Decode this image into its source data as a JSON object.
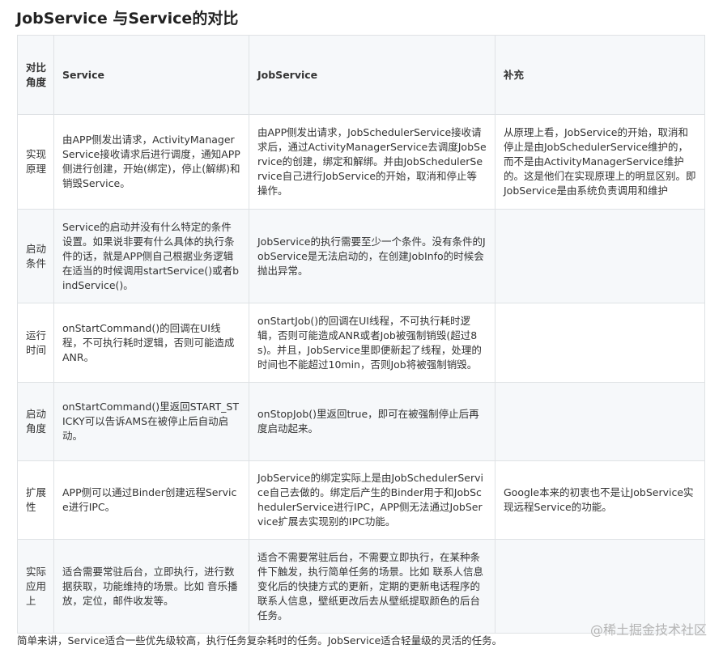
{
  "title": "JobService 与Service的对比",
  "table": {
    "headers": [
      "对比角度",
      "Service",
      "JobService",
      "补充"
    ],
    "rows": [
      [
        "实现原理",
        "由APP侧发出请求，ActivityManagerService接收请求后进行调度，通知APP侧进行创建，开始(绑定)，停止(解绑)和销毁Service。",
        "由APP侧发出请求，JobSchedulerService接收请求后，通过ActivityManagerService去调度JobService的创建，绑定和解绑。并由JobSchedulerService自己进行JobService的开始，取消和停止等操作。",
        "从原理上看，JobService的开始，取消和停止是由JobSchedulerService维护的，而不是由ActivityManagerService维护的。这是他们在实现原理上的明显区别。即JobService是由系统负责调用和维护"
      ],
      [
        "启动条件",
        "Service的启动并没有什么特定的条件设置。如果说非要有什么具体的执行条件的话，就是APP侧自己根据业务逻辑在适当的时候调用startService()或者bindService()。",
        "JobService的执行需要至少一个条件。没有条件的JobService是无法启动的，在创建JobInfo的时候会抛出异常。",
        ""
      ],
      [
        "运行时间",
        "onStartCommand()的回调在UI线程，不可执行耗时逻辑，否则可能造成ANR。",
        "onStartJob()的回调在UI线程，不可执行耗时逻辑，否则可能造成ANR或者Job被强制销毁(超过8s)。并且，JobService里即便新起了线程，处理的时间也不能超过10min，否则Job将被强制销毁。",
        ""
      ],
      [
        "启动角度",
        "onStartCommand()里返回START_STICKY可以告诉AMS在被停止后自动启动。",
        "onStopJob()里返回true，即可在被强制停止后再度启动起来。",
        ""
      ],
      [
        "扩展性",
        "APP侧可以通过Binder创建远程Service进行IPC。",
        "JobService的绑定实际上是由JobSchedulerService自己去做的。绑定后产生的Binder用于和JobSchedulerService进行IPC，APP侧无法通过JobService扩展去实现别的IPC功能。",
        "Google本来的初衷也不是让JobService实现远程Service的功能。"
      ],
      [
        "实际应用上",
        "适合需要常驻后台，立即执行，进行数据获取，功能维持的场景。比如 音乐播放，定位，邮件收发等。",
        "适合不需要常驻后台，不需要立即执行，在某种条件下触发，执行简单任务的场景。比如 联系人信息变化后的快捷方式的更新，定期的更新电话程序的联系人信息，壁纸更改后去从壁纸提取颜色的后台任务。",
        ""
      ]
    ]
  },
  "footer": "简单来讲，Service适合一些优先级较高，执行任务复杂耗时的任务。JobService适合轻量级的灵活的任务。",
  "watermark": "@稀土掘金技术社区"
}
